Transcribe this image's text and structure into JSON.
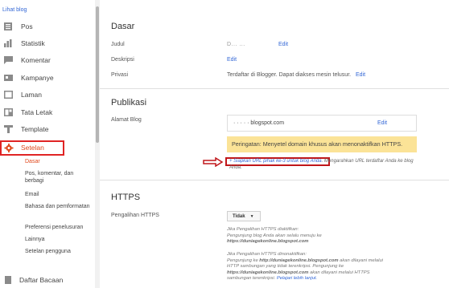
{
  "sidebar": {
    "view_blog": "Lihat blog",
    "items": [
      {
        "label": "Pos",
        "icon": "posts-icon"
      },
      {
        "label": "Statistik",
        "icon": "stats-icon"
      },
      {
        "label": "Komentar",
        "icon": "comments-icon"
      },
      {
        "label": "Kampanye",
        "icon": "campaigns-icon"
      },
      {
        "label": "Laman",
        "icon": "pages-icon"
      },
      {
        "label": "Tata Letak",
        "icon": "layout-icon"
      },
      {
        "label": "Template",
        "icon": "template-icon"
      },
      {
        "label": "Setelan",
        "icon": "gear-icon"
      }
    ],
    "sub_items": [
      "Dasar",
      "Pos, komentar, dan berbagi",
      "Email",
      "Bahasa dan pemformatan",
      "Preferensi penelusuran",
      "Lainnya",
      "Setelan pengguna"
    ],
    "bottom": "Daftar Bacaan"
  },
  "main": {
    "basic": {
      "title": "Dasar",
      "judul_label": "Judul",
      "judul_value": "D... ...",
      "deskripsi_label": "Deskripsi",
      "privasi_label": "Privasi",
      "privasi_value": "Terdaftar di Blogger. Dapat diakses mesin telusur.",
      "edit": "Edit"
    },
    "publishing": {
      "title": "Publikasi",
      "address_label": "Alamat Blog",
      "url": "blogspot.com",
      "edit": "Edit",
      "warning": "Peringatan: Menyetel domain khusus akan menonaktifkan HTTPS.",
      "setup_link": "+ Siapkan URL pihak ke-3 untuk blog Anda",
      "setup_rest": ". Mengarahkan URL terdaftar Anda ke blog Anda."
    },
    "https": {
      "title": "HTTPS",
      "redirect_label": "Pengalihan HTTPS",
      "dropdown_value": "Tidak",
      "help_on_1": "Jika Pengalihan HTTPS diaktifkan:",
      "help_on_2": "Pengunjung blog Anda akan selalu menuju ke",
      "help_on_3": "https://duniagekonline.blogspot.com",
      "help_off_1": "Jika Pengalihan HTTPS dinonaktifkan:",
      "help_off_2a": "Pengunjung ke ",
      "help_off_2b": "http://duniagekonline.blogspot.com",
      "help_off_2c": " akan dilayani melalui",
      "help_off_3": "HTTP sambungan yang tidak terenkripsi. Pengunjung ke",
      "help_off_4a": "https://duniagekonline.blogspot.com",
      "help_off_4b": " akan dilayani melalui HTTPS",
      "help_off_5": "sambungan terenkripsi.",
      "learn_more": "Pelajari lebih lanjut."
    }
  },
  "colors": {
    "accent": "#e0491d",
    "link": "#3367d6",
    "warning_bg": "#fbe397",
    "highlight": "#e02424"
  }
}
